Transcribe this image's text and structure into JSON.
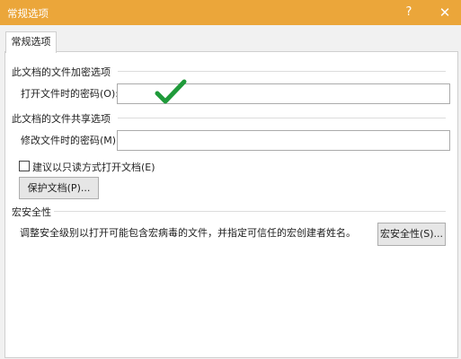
{
  "window": {
    "title": "常规选项",
    "help_button": "?",
    "close_button": "✕"
  },
  "tab": {
    "label": "常规选项"
  },
  "encryption": {
    "section_title": "此文档的文件加密选项",
    "open_password_label": "打开文件时的密码(O):",
    "open_password_value": ""
  },
  "sharing": {
    "section_title": "此文档的文件共享选项",
    "modify_password_label": "修改文件时的密码(M):",
    "modify_password_value": "",
    "readonly_label": "建议以只读方式打开文档(E)",
    "readonly_checked": false,
    "protect_button": "保护文档(P)..."
  },
  "macro": {
    "section_title": "宏安全性",
    "description": "调整安全级别以打开可能包含宏病毒的文件，并指定可信任的宏创建者姓名。",
    "button": "宏安全性(S)..."
  },
  "colors": {
    "titlebar": "#eba63a",
    "checkmark": "#1f9a3a"
  }
}
